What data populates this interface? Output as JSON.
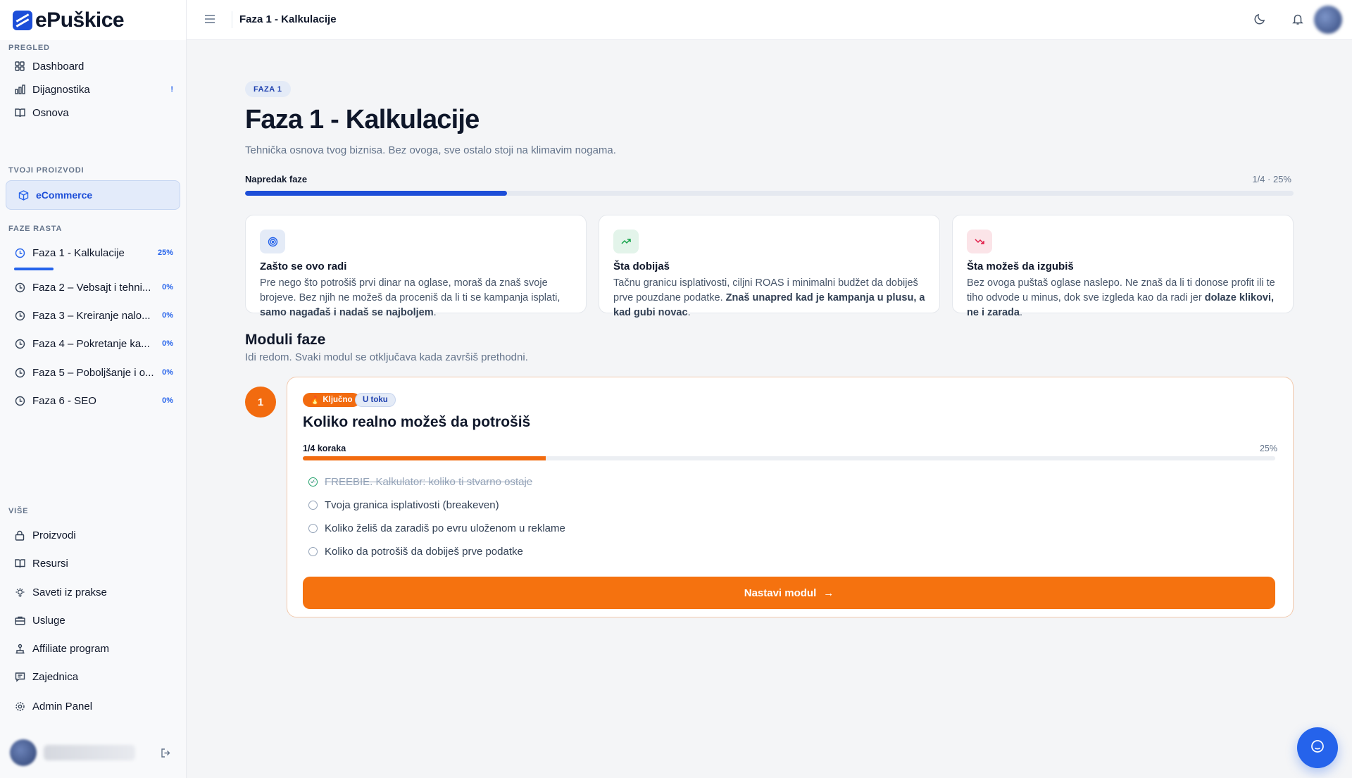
{
  "brand": {
    "name": "ePuškice",
    "accent": "#1d4ed8",
    "cta_color": "#f5720f"
  },
  "topbar": {
    "title": "Faza 1 - Kalkulacije"
  },
  "sidebar": {
    "sections": {
      "overview": "PREGLED",
      "products": "TVOJI PROIZVODI",
      "phases": "FAZE RASTA",
      "more": "VIŠE"
    },
    "overview_items": [
      {
        "label": "Dashboard",
        "icon": "grid-icon"
      },
      {
        "label": "Dijagnostika",
        "icon": "bar-chart-icon",
        "badge": "!"
      },
      {
        "label": "Osnova",
        "icon": "book-icon"
      }
    ],
    "product_item": {
      "label": "eCommerce",
      "icon": "box-icon"
    },
    "phase_items": [
      {
        "label": "Faza 1 - Kalkulacije",
        "pct": "25%"
      },
      {
        "label": "Faza 2 – Vebsajt i tehni...",
        "pct": "0%"
      },
      {
        "label": "Faza 3 – Kreiranje nalo...",
        "pct": "0%"
      },
      {
        "label": "Faza 4 – Pokretanje ka...",
        "pct": "0%"
      },
      {
        "label": "Faza 5 – Poboljšanje i o...",
        "pct": "0%"
      },
      {
        "label": "Faza 6 - SEO",
        "pct": "0%"
      }
    ],
    "more_items": [
      {
        "label": "Proizvodi",
        "icon": "lock-icon"
      },
      {
        "label": "Resursi",
        "icon": "book-icon"
      },
      {
        "label": "Saveti iz prakse",
        "icon": "lightbulb-icon"
      },
      {
        "label": "Usluge",
        "icon": "briefcase-icon"
      },
      {
        "label": "Affiliate program",
        "icon": "network-icon"
      },
      {
        "label": "Zajednica",
        "icon": "chat-icon"
      },
      {
        "label": "Admin Panel",
        "icon": "gear-icon"
      }
    ]
  },
  "page": {
    "badge": "FAZA 1",
    "title": "Faza 1 - Kalkulacije",
    "subtitle": "Tehnička osnova tvog biznisa. Bez ovoga, sve ostalo stoji na klimavim nogama.",
    "progress_label": "Napredak faze",
    "progress_text": "1/4 · 25%",
    "progress": 0.25
  },
  "info_cards": [
    {
      "title": "Zašto se ovo radi",
      "text_a": "Pre nego što potrošiš prvi dinar na oglase, moraš da znaš svoje brojeve. Bez njih ne možeš da proceniš da li ti se kampanja isplati, ",
      "bold": "samo nagađaš i nadaš se najboljem",
      "text_b": ".",
      "icon": "target-icon",
      "color": "#e4ebf7"
    },
    {
      "title": "Šta dobijaš",
      "text_a": "Tačnu granicu isplativosti, ciljni ROAS i minimalni budžet da dobiješ prve pouzdane podatke. ",
      "bold": "Znaš unapred kad je kampanja u plusu, a kad gubi novac",
      "text_b": ".",
      "icon": "trending-up-icon",
      "color": "#e3f4ea"
    },
    {
      "title": "Šta možeš da izgubiš",
      "text_a": "Bez ovoga puštaš oglase naslepo. Ne znaš da li ti donose profit ili te tiho odvode u minus, dok sve izgleda kao da radi jer ",
      "bold": "dolaze klikovi, ne i zarada",
      "text_b": ".",
      "icon": "trending-down-icon",
      "color": "#fbe4e8"
    }
  ],
  "modules": {
    "title": "Moduli faze",
    "subtitle": "Idi redom. Svaki modul se otključava kada završiš prethodni.",
    "module": {
      "number": "1",
      "tag_key": "Ključno",
      "tag_status": "U toku",
      "title": "Koliko realno možeš da potrošiš",
      "steps_label": "1/4 koraka",
      "steps_pct": "25%",
      "progress": 0.25,
      "steps": [
        {
          "label": "FREEBIE. Kalkulator: koliko ti stvarno ostaje",
          "done": true
        },
        {
          "label": "Tvoja granica isplativosti (breakeven)",
          "done": false
        },
        {
          "label": "Koliko želiš da zaradiš po evru uloženom u reklame",
          "done": false
        },
        {
          "label": "Koliko da potrošiš da dobiješ prve podatke",
          "done": false
        }
      ],
      "cta": "Nastavi modul",
      "cta_arrow": "→"
    }
  }
}
